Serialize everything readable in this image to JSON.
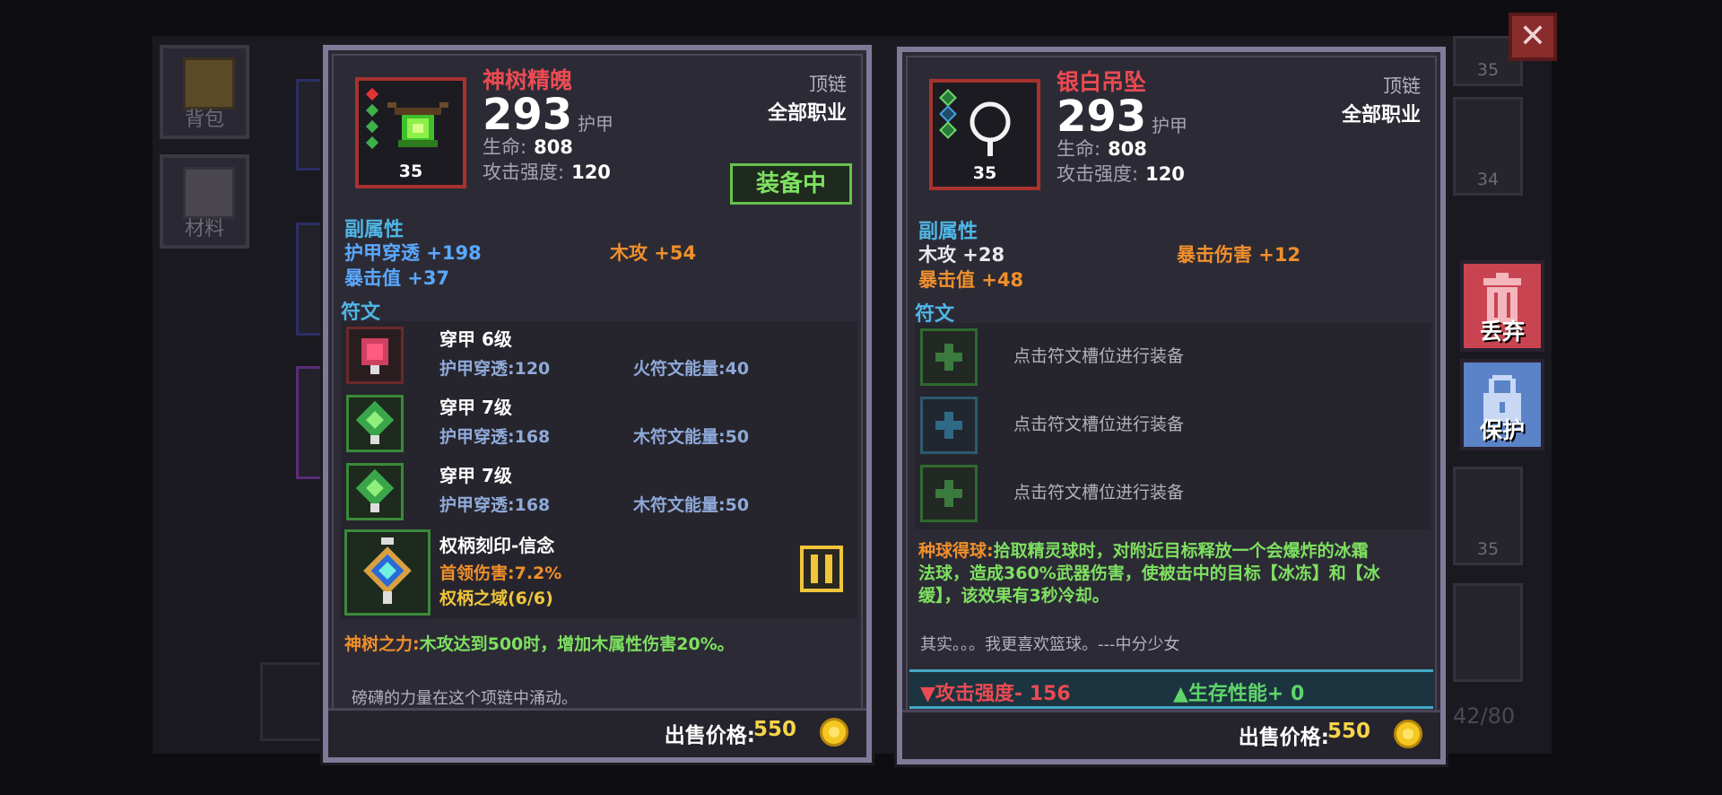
{
  "background": {
    "tabs": [
      {
        "label": "背包"
      },
      {
        "label": "材料"
      }
    ],
    "slot_levels": [
      "35",
      "34",
      "35"
    ],
    "capacity": "42/80"
  },
  "side_buttons": {
    "discard": "丢弃",
    "protect": "保护"
  },
  "left": {
    "name": "神树精魄",
    "level": "35",
    "power": "293",
    "power_label": "护甲",
    "slot": "顶链",
    "class": "全部职业",
    "hp_label": "生命:",
    "hp": "808",
    "atk_label": "攻击强度:",
    "atk": "120",
    "equipped": "装备中",
    "sub_title": "副属性",
    "subs": [
      "护甲穿透 +198",
      "木攻 +54",
      "暴击值 +37"
    ],
    "rune_title": "符文",
    "runes": [
      {
        "name": "穿甲 6级",
        "stat1": "护甲穿透:120",
        "stat2": "火符文能量:40"
      },
      {
        "name": "穿甲 7级",
        "stat1": "护甲穿透:168",
        "stat2": "木符文能量:50"
      },
      {
        "name": "穿甲 7级",
        "stat1": "护甲穿透:168",
        "stat2": "木符文能量:50"
      }
    ],
    "set": {
      "name": "权柄刻印-信念",
      "line1": "首领伤害:7.2%",
      "line2": "权柄之域(6/6)"
    },
    "passive_name": "神树之力:",
    "passive_text": "木攻达到500时，增加木属性伤害20%。",
    "flavor": "磅礴的力量在这个项链中涌动。",
    "price_label": "出售价格:",
    "price": "550"
  },
  "right": {
    "name": "银白吊坠",
    "level": "35",
    "power": "293",
    "power_label": "护甲",
    "slot": "顶链",
    "class": "全部职业",
    "hp_label": "生命:",
    "hp": "808",
    "atk_label": "攻击强度:",
    "atk": "120",
    "sub_title": "副属性",
    "subs": [
      "木攻 +28",
      "暴击伤害 +12",
      "暴击值 +48"
    ],
    "rune_title": "符文",
    "rune_hint": "点击符文槽位进行装备",
    "passive_name": "种球得球:",
    "passive_text1": "拾取精灵球时，对附近目标释放一个会爆炸的冰霜",
    "passive_text2": "法球，造成360%武器伤害，使被击中的目标【冰冻】和【冰",
    "passive_text3": "缓】，该效果有3秒冷却。",
    "flavor": "其实。。。我更喜欢篮球。---中分少女",
    "compare_down": "▼攻击强度- 156",
    "compare_up": "▲生存性能+ 0",
    "price_label": "出售价格:",
    "price": "550"
  },
  "colors": {
    "name_red": "#ec4a52",
    "orange": "#f08f2c",
    "blue": "#5aa8ff",
    "green": "#7ee060",
    "gold": "#f6d548"
  }
}
